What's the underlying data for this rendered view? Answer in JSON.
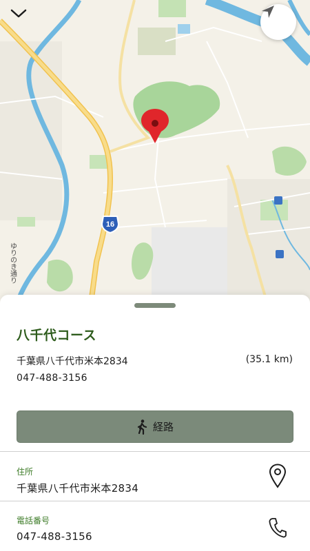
{
  "map": {
    "route_shield": "16",
    "street_label": "ゆりのき通り",
    "icons": {
      "collapse": "chevron-down-icon",
      "locate": "location-arrow-icon",
      "pin": "map-pin-icon"
    }
  },
  "place": {
    "name": "八千代コース",
    "address": "千葉県八千代市米本2834",
    "distance": "(35.1 km)",
    "phone": "047-488-3156"
  },
  "route_button": {
    "label": "経路",
    "icon": "walking-person-icon"
  },
  "address_section": {
    "label": "住所",
    "value": "千葉県八千代市米本2834",
    "icon": "map-marker-outline-icon"
  },
  "phone_section": {
    "label": "電話番号",
    "value": "047-488-3156",
    "icon": "phone-icon"
  },
  "colors": {
    "accent_green": "#2e5c1c",
    "button_green": "#7b8a7a",
    "pin_red": "#e0262b",
    "water": "#6fb8e0",
    "park": "#a8d59a",
    "road": "#f7d77a"
  }
}
